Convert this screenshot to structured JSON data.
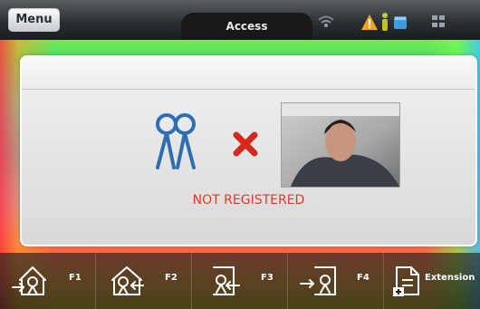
{
  "topbar": {
    "menu_label": "Menu",
    "title": "Access",
    "status_icons": [
      "wifi-icon",
      "warning-icon",
      "person-icon",
      "device-icon",
      "network-icon"
    ]
  },
  "panel": {
    "status_message": "NOT REGISTERED",
    "icons": [
      "users-icon",
      "error-x-icon"
    ],
    "photo": "camera-photo"
  },
  "bottombar": {
    "keys": [
      {
        "label": "F1",
        "icon": "entry-icon"
      },
      {
        "label": "F2",
        "icon": "home-return-icon"
      },
      {
        "label": "F3",
        "icon": "exit-icon"
      },
      {
        "label": "F4",
        "icon": "entry-icon"
      },
      {
        "label": "Extension",
        "icon": "add-document-icon"
      }
    ]
  },
  "colors": {
    "status_red": "#e23a2a",
    "icon_blue": "#2f6fb1",
    "x_red": "#d72a1e"
  }
}
